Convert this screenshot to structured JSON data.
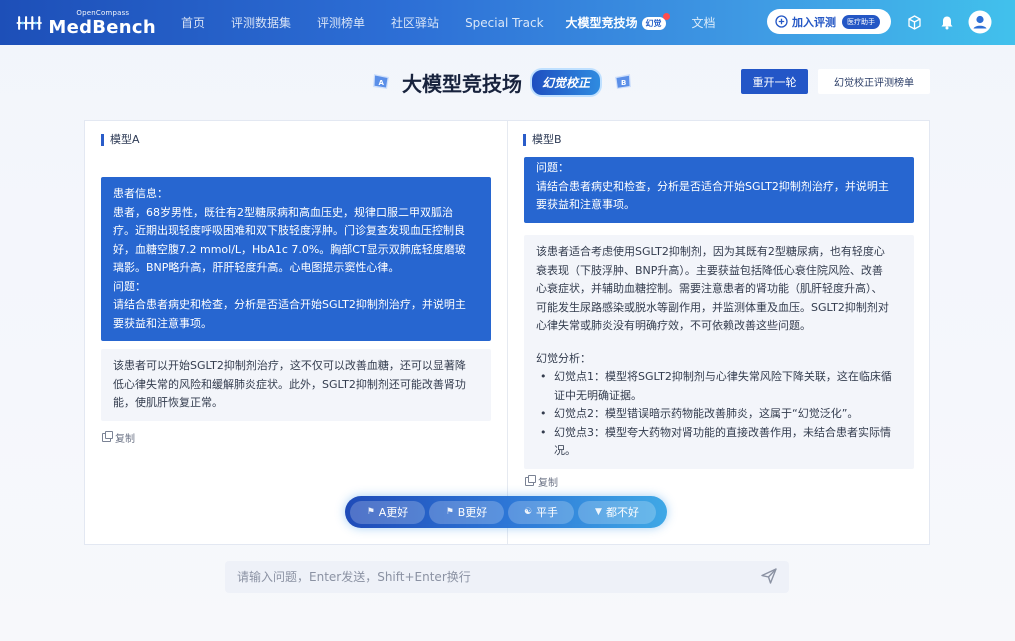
{
  "header": {
    "logo_small": "OpenCompass",
    "logo_big": "MedBench",
    "nav": [
      {
        "label": "首页",
        "active": false
      },
      {
        "label": "评测数据集",
        "active": false
      },
      {
        "label": "评测榜单",
        "active": false
      },
      {
        "label": "社区驿站",
        "active": false
      },
      {
        "label": "Special Track",
        "active": false
      },
      {
        "label": "大模型竞技场",
        "active": true,
        "badge": "幻觉"
      },
      {
        "label": "文档",
        "active": false
      }
    ],
    "join_label": "加入评测",
    "join_tag": "医疗助手",
    "icons": [
      "cube-icon",
      "bell-icon",
      "user-icon"
    ]
  },
  "title_row": {
    "title": "大模型竞技场",
    "tag": "幻觉校正",
    "flag_a": "A",
    "flag_b": "B",
    "restart_label": "重开一轮",
    "board_label": "幻觉校正评测榜单"
  },
  "panel_a": {
    "title": "模型A",
    "question_lines": [
      "患者信息：",
      "患者，68岁男性，既往有2型糖尿病和高血压史，规律口服二甲双胍治",
      "疗。近期出现轻度呼吸困难和双下肢轻度浮肿。门诊复查发现血压控制良",
      "好，血糖空腹7.2 mmol/L，HbA1c 7.0%。胸部CT显示双肺底轻度磨玻",
      "璃影。BNP略升高，肝肝轻度升高。心电图提示窦性心律。",
      "问题：",
      "请结合患者病史和检查，分析是否适合开始SGLT2抑制剂治疗，并说明主",
      "要获益和注意事项。"
    ],
    "answer_lines": [
      "该患者可以开始SGLT2抑制剂治疗，这不仅可以改善血糖，还可以显著降",
      "低心律失常的风险和缓解肺炎症状。此外，SGLT2抑制剂还可能改善肾功",
      "能，使肌肝恢复正常。"
    ],
    "copy_label": "复制"
  },
  "panel_b": {
    "title": "模型B",
    "question_lines": [
      "问题：",
      "请结合患者病史和检查，分析是否适合开始SGLT2抑制剂治疗，并说明主",
      "要获益和注意事项。"
    ],
    "answer_lines": [
      "该患者适合考虑使用SGLT2抑制剂，因为其既有2型糖尿病，也有轻度心",
      "衰表现（下肢浮肿、BNP升高）。主要获益包括降低心衰住院风险、改善",
      "心衰症状，并辅助血糖控制。需要注意患者的肾功能（肌肝轻度升高）、",
      "可能发生尿路感染或脱水等副作用，并监测体重及血压。SGLT2抑制剂对",
      "心律失常或肺炎没有明确疗效，不可依赖改善这些问题。"
    ],
    "analysis_title": "幻觉分析：",
    "analysis_points": [
      {
        "l1": "幻觉点1：模型将SGLT2抑制剂与心律失常风险下降关联，这在临床循",
        "l2": "证中无明确证据。"
      },
      {
        "l1": "幻觉点2：模型错误暗示药物能改善肺炎，这属于“幻觉泛化”。",
        "l2": ""
      },
      {
        "l1": "幻觉点3：模型夸大药物对肾功能的直接改善作用，未结合患者实际情",
        "l2": "况。"
      }
    ],
    "copy_label": "复制"
  },
  "vote": {
    "buttons": [
      {
        "label": "A更好",
        "icon": "thumb-a-icon"
      },
      {
        "label": "B更好",
        "icon": "thumb-b-icon"
      },
      {
        "label": "平手",
        "icon": "handshake-icon"
      },
      {
        "label": "都不好",
        "icon": "thumb-down-icon"
      }
    ]
  },
  "input": {
    "placeholder": "请输入问题，Enter发送，Shift+Enter换行"
  },
  "colors": {
    "primary": "#2356c7",
    "bubble_blue": "#2766d0",
    "bubble_gray": "#f3f5fa"
  }
}
